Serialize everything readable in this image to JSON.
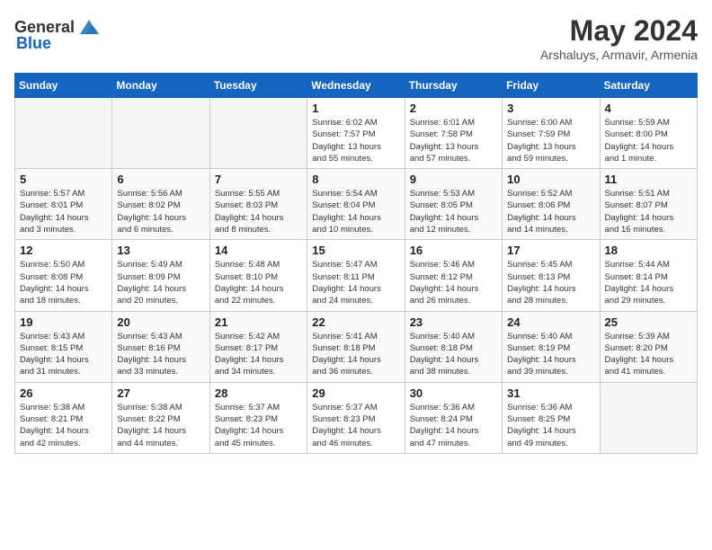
{
  "header": {
    "logo_general": "General",
    "logo_blue": "Blue",
    "month_year": "May 2024",
    "location": "Arshaluys, Armavir, Armenia"
  },
  "weekdays": [
    "Sunday",
    "Monday",
    "Tuesday",
    "Wednesday",
    "Thursday",
    "Friday",
    "Saturday"
  ],
  "weeks": [
    [
      {
        "day": "",
        "info": ""
      },
      {
        "day": "",
        "info": ""
      },
      {
        "day": "",
        "info": ""
      },
      {
        "day": "1",
        "info": "Sunrise: 6:02 AM\nSunset: 7:57 PM\nDaylight: 13 hours\nand 55 minutes."
      },
      {
        "day": "2",
        "info": "Sunrise: 6:01 AM\nSunset: 7:58 PM\nDaylight: 13 hours\nand 57 minutes."
      },
      {
        "day": "3",
        "info": "Sunrise: 6:00 AM\nSunset: 7:59 PM\nDaylight: 13 hours\nand 59 minutes."
      },
      {
        "day": "4",
        "info": "Sunrise: 5:59 AM\nSunset: 8:00 PM\nDaylight: 14 hours\nand 1 minute."
      }
    ],
    [
      {
        "day": "5",
        "info": "Sunrise: 5:57 AM\nSunset: 8:01 PM\nDaylight: 14 hours\nand 3 minutes."
      },
      {
        "day": "6",
        "info": "Sunrise: 5:56 AM\nSunset: 8:02 PM\nDaylight: 14 hours\nand 6 minutes."
      },
      {
        "day": "7",
        "info": "Sunrise: 5:55 AM\nSunset: 8:03 PM\nDaylight: 14 hours\nand 8 minutes."
      },
      {
        "day": "8",
        "info": "Sunrise: 5:54 AM\nSunset: 8:04 PM\nDaylight: 14 hours\nand 10 minutes."
      },
      {
        "day": "9",
        "info": "Sunrise: 5:53 AM\nSunset: 8:05 PM\nDaylight: 14 hours\nand 12 minutes."
      },
      {
        "day": "10",
        "info": "Sunrise: 5:52 AM\nSunset: 8:06 PM\nDaylight: 14 hours\nand 14 minutes."
      },
      {
        "day": "11",
        "info": "Sunrise: 5:51 AM\nSunset: 8:07 PM\nDaylight: 14 hours\nand 16 minutes."
      }
    ],
    [
      {
        "day": "12",
        "info": "Sunrise: 5:50 AM\nSunset: 8:08 PM\nDaylight: 14 hours\nand 18 minutes."
      },
      {
        "day": "13",
        "info": "Sunrise: 5:49 AM\nSunset: 8:09 PM\nDaylight: 14 hours\nand 20 minutes."
      },
      {
        "day": "14",
        "info": "Sunrise: 5:48 AM\nSunset: 8:10 PM\nDaylight: 14 hours\nand 22 minutes."
      },
      {
        "day": "15",
        "info": "Sunrise: 5:47 AM\nSunset: 8:11 PM\nDaylight: 14 hours\nand 24 minutes."
      },
      {
        "day": "16",
        "info": "Sunrise: 5:46 AM\nSunset: 8:12 PM\nDaylight: 14 hours\nand 26 minutes."
      },
      {
        "day": "17",
        "info": "Sunrise: 5:45 AM\nSunset: 8:13 PM\nDaylight: 14 hours\nand 28 minutes."
      },
      {
        "day": "18",
        "info": "Sunrise: 5:44 AM\nSunset: 8:14 PM\nDaylight: 14 hours\nand 29 minutes."
      }
    ],
    [
      {
        "day": "19",
        "info": "Sunrise: 5:43 AM\nSunset: 8:15 PM\nDaylight: 14 hours\nand 31 minutes."
      },
      {
        "day": "20",
        "info": "Sunrise: 5:43 AM\nSunset: 8:16 PM\nDaylight: 14 hours\nand 33 minutes."
      },
      {
        "day": "21",
        "info": "Sunrise: 5:42 AM\nSunset: 8:17 PM\nDaylight: 14 hours\nand 34 minutes."
      },
      {
        "day": "22",
        "info": "Sunrise: 5:41 AM\nSunset: 8:18 PM\nDaylight: 14 hours\nand 36 minutes."
      },
      {
        "day": "23",
        "info": "Sunrise: 5:40 AM\nSunset: 8:18 PM\nDaylight: 14 hours\nand 38 minutes."
      },
      {
        "day": "24",
        "info": "Sunrise: 5:40 AM\nSunset: 8:19 PM\nDaylight: 14 hours\nand 39 minutes."
      },
      {
        "day": "25",
        "info": "Sunrise: 5:39 AM\nSunset: 8:20 PM\nDaylight: 14 hours\nand 41 minutes."
      }
    ],
    [
      {
        "day": "26",
        "info": "Sunrise: 5:38 AM\nSunset: 8:21 PM\nDaylight: 14 hours\nand 42 minutes."
      },
      {
        "day": "27",
        "info": "Sunrise: 5:38 AM\nSunset: 8:22 PM\nDaylight: 14 hours\nand 44 minutes."
      },
      {
        "day": "28",
        "info": "Sunrise: 5:37 AM\nSunset: 8:23 PM\nDaylight: 14 hours\nand 45 minutes."
      },
      {
        "day": "29",
        "info": "Sunrise: 5:37 AM\nSunset: 8:23 PM\nDaylight: 14 hours\nand 46 minutes."
      },
      {
        "day": "30",
        "info": "Sunrise: 5:36 AM\nSunset: 8:24 PM\nDaylight: 14 hours\nand 47 minutes."
      },
      {
        "day": "31",
        "info": "Sunrise: 5:36 AM\nSunset: 8:25 PM\nDaylight: 14 hours\nand 49 minutes."
      },
      {
        "day": "",
        "info": ""
      }
    ]
  ]
}
